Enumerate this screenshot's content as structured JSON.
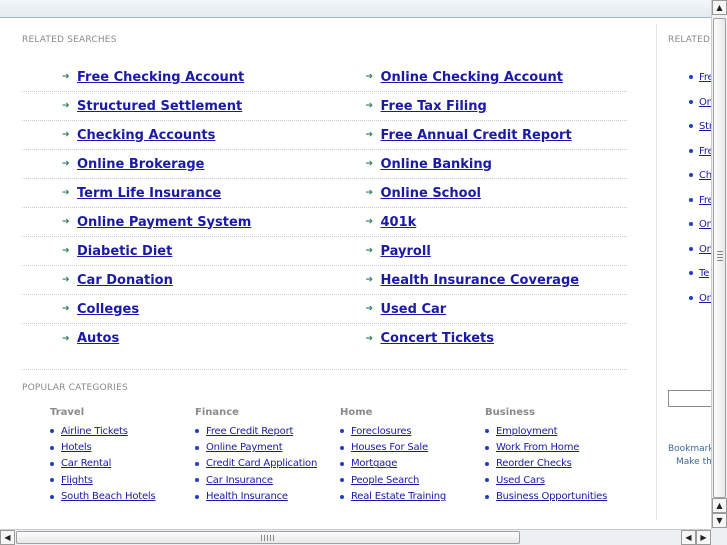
{
  "related_searches": {
    "title": "RELATED SEARCHES",
    "left": [
      "Free Checking Account",
      "Structured Settlement",
      "Checking Accounts",
      "Online Brokerage",
      "Term Life Insurance",
      "Online Payment System",
      "Diabetic Diet",
      "Car Donation",
      "Colleges",
      "Autos"
    ],
    "right": [
      "Online Checking Account",
      "Free Tax Filing",
      "Free Annual Credit Report",
      "Online Banking",
      "Online School",
      "401k",
      "Payroll",
      "Health Insurance Coverage",
      "Used Car",
      "Concert Tickets"
    ]
  },
  "popular_categories": {
    "title": "POPULAR CATEGORIES",
    "columns": [
      {
        "heading": "Travel",
        "items": [
          "Airline Tickets",
          "Hotels",
          "Car Rental",
          "Flights",
          "South Beach Hotels"
        ]
      },
      {
        "heading": "Finance",
        "items": [
          "Free Credit Report",
          "Online Payment",
          "Credit Card Application",
          "Car Insurance",
          "Health Insurance"
        ]
      },
      {
        "heading": "Home",
        "items": [
          "Foreclosures",
          "Houses For Sale",
          "Mortgage",
          "People Search",
          "Real Estate Training"
        ]
      },
      {
        "heading": "Business",
        "items": [
          "Employment",
          "Work From Home",
          "Reorder Checks",
          "Used Cars",
          "Business Opportunities"
        ]
      }
    ]
  },
  "right_panel": {
    "title": "RELATED",
    "items": [
      "Fre",
      "Onl",
      "Str",
      "Fre",
      "Ch",
      "Fre",
      "Onl",
      "Onl",
      "Te",
      "Onl"
    ],
    "bookmark_text": "Bookmark",
    "make_text": "Make thi"
  },
  "colors": {
    "link": "#1a1aa6",
    "arrow": "#2f7f5a",
    "muted": "#8a8a8a"
  },
  "icons": {
    "arrow": "right-arrow-icon",
    "bullet": "bullet-icon",
    "scroll_up": "triangle-up",
    "scroll_down": "triangle-down",
    "scroll_left": "triangle-left",
    "scroll_right": "triangle-right"
  }
}
